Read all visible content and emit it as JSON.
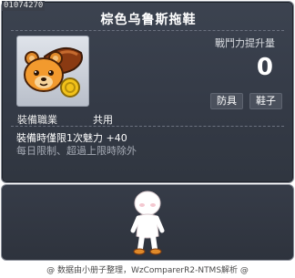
{
  "item": {
    "id": "01074270",
    "name": "棕色乌鲁斯拖鞋",
    "icon": "bear-slipper-icon"
  },
  "stats": {
    "power_label": "戰鬥力提升量",
    "power_value": "0"
  },
  "tags": [
    "防具",
    "鞋子"
  ],
  "requirement": {
    "label": "裝備職業",
    "value": "共用"
  },
  "effect": "裝備時僅限1次魅力 +40",
  "note": "每日限制、超過上限時除外",
  "preview": {
    "character": "mannequin-character"
  },
  "footer": "@ 数据由小册子整理，WzComparerR2-NTMS解析 @",
  "colors": {
    "panel": "#343a46",
    "border": "#8a8f99",
    "title": "#ffffff",
    "note": "#a6abb5"
  }
}
